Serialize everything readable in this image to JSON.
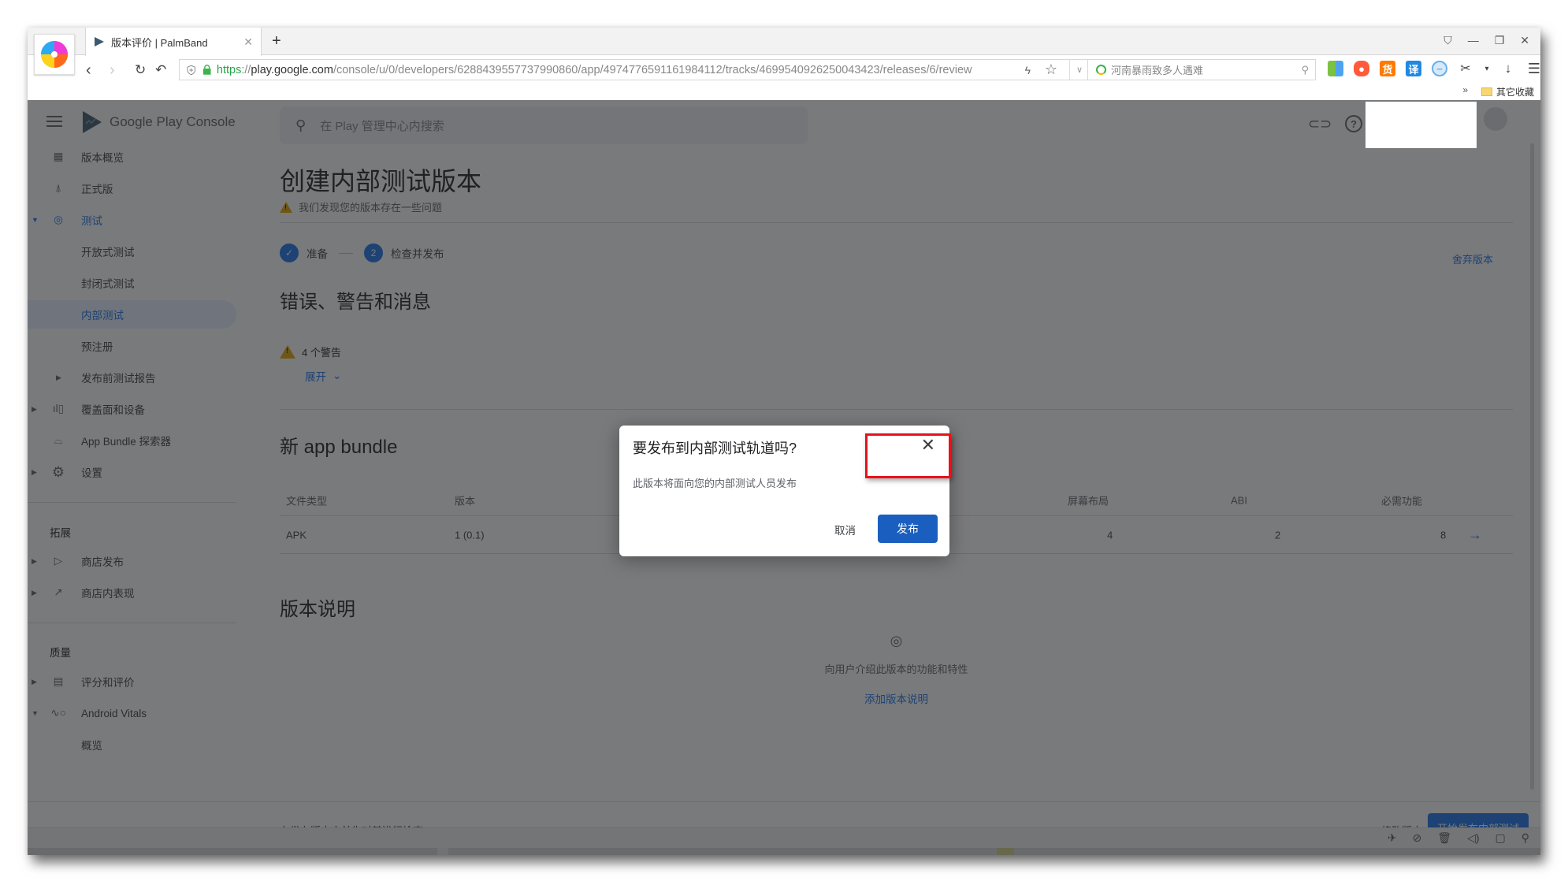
{
  "browser": {
    "tab_title": "版本评价 | PalmBand",
    "new_tab_label": "+",
    "url_scheme": "https",
    "url_host": "play.google.com",
    "url_path": "/console/u/0/developers/6288439557737990860/app/4974776591161984112/tracks/4699540926250043423/releases/6/review",
    "search_placeholder": "河南暴雨致多人遇难",
    "bookmarks_more": "»",
    "bookmarks_folder": "其它收藏",
    "extensions": [
      {
        "name": "apps-grid-icon",
        "glyph": "▦",
        "color": "#7bc142"
      },
      {
        "name": "game-icon",
        "glyph": "◕",
        "color": "#ff5a3c"
      },
      {
        "name": "goods-icon",
        "glyph": "货",
        "color": "#ff7a00"
      },
      {
        "name": "translate-icon",
        "glyph": "译",
        "color": "#1e88e5"
      },
      {
        "name": "minus-circle-icon",
        "glyph": "⊖",
        "color": "#6aaee8"
      }
    ]
  },
  "console": {
    "brand_google": "Google Play",
    "brand_console": "Console",
    "search_placeholder": "在 Play 管理中心内搜索",
    "sidebar": {
      "items": [
        {
          "label": "版本概览",
          "icon": "dashboard-icon"
        },
        {
          "label": "正式版",
          "icon": "production-icon"
        },
        {
          "label": "测试",
          "icon": "testing-icon"
        },
        {
          "label": "开放式测试"
        },
        {
          "label": "封闭式测试"
        },
        {
          "label": "内部测试"
        },
        {
          "label": "预注册"
        },
        {
          "label": "发布前测试报告"
        },
        {
          "label": "覆盖面和设备",
          "icon": "reach-devices-icon"
        },
        {
          "label": "App Bundle 探索器",
          "icon": "app-bundle-icon"
        },
        {
          "label": "设置",
          "icon": "settings-icon"
        },
        {
          "label": "商店发布",
          "icon": "store-presence-icon"
        },
        {
          "label": "商店内表现",
          "icon": "store-performance-icon"
        },
        {
          "label": "评分和评价",
          "icon": "ratings-icon"
        },
        {
          "label": "Android Vitals",
          "icon": "vitals-icon"
        },
        {
          "label": "概览"
        }
      ],
      "sections": [
        "拓展",
        "质量"
      ]
    },
    "page_title": "创建内部测试版本",
    "issue_notice": "我们发现您的版本存在一些问题",
    "steps": [
      {
        "number": "✓",
        "label": "准备"
      },
      {
        "number": "2",
        "label": "检查并发布"
      }
    ],
    "discard_label": "舍弃版本",
    "messages_heading": "错误、警告和消息",
    "warning_count": "4 个警告",
    "expand_label": "展开",
    "bundle_heading": "新 app bundle",
    "table": {
      "headers": [
        "文件类型",
        "版本",
        "屏幕布局",
        "ABI",
        "必需功能"
      ],
      "rows": [
        {
          "type": "APK",
          "version": "1 (0.1)",
          "screens": "4",
          "abi": "2",
          "features": "8"
        }
      ]
    },
    "notes_heading": "版本说明",
    "notes_empty_text": "向用户介绍此版本的功能和特性",
    "notes_add_link": "添加版本说明",
    "footer": {
      "hint": "在发布版本之前先对其进行检查",
      "edit_label": "修改版本",
      "start_label": "开始发布内部测试"
    }
  },
  "dialog": {
    "title": "要发布到内部测试轨道吗?",
    "body": "此版本将面向您的内部测试人员发布",
    "cancel_label": "取消",
    "publish_label": "发布"
  }
}
